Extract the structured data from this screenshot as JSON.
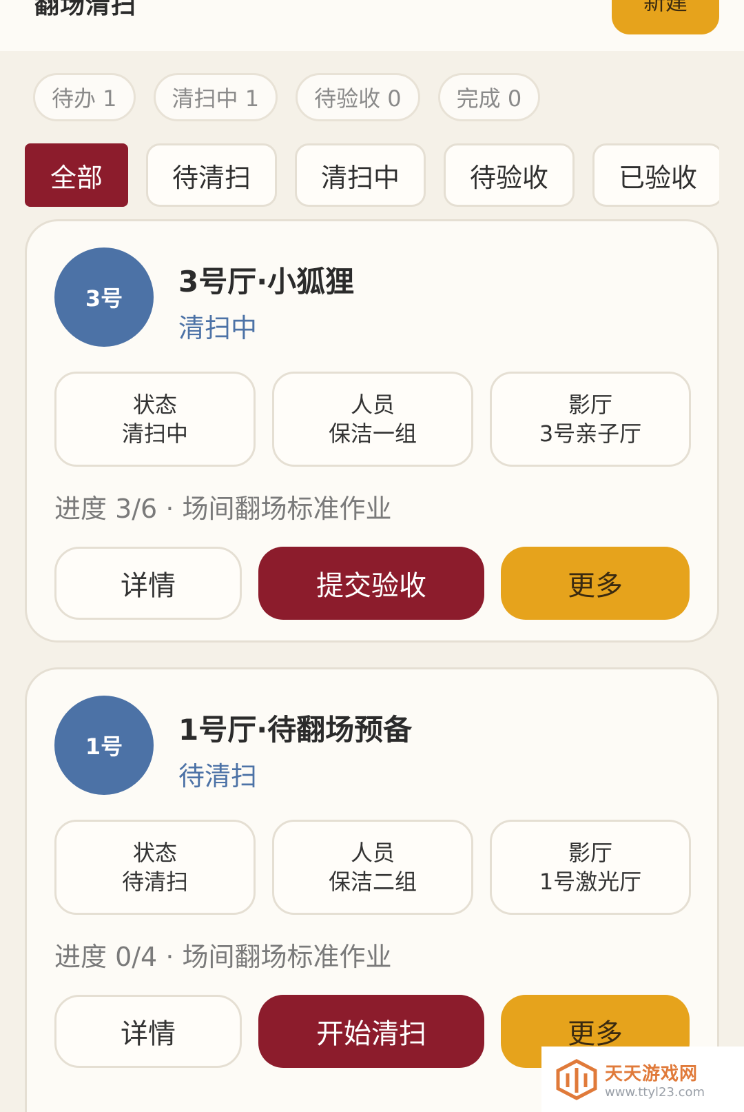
{
  "header": {
    "title": "翻场清扫",
    "new_button": "新建"
  },
  "count_chips": [
    {
      "label": "待办 1"
    },
    {
      "label": "清扫中 1"
    },
    {
      "label": "待验收 0"
    },
    {
      "label": "完成 0"
    }
  ],
  "filter_tabs": [
    {
      "label": "全部",
      "active": true
    },
    {
      "label": "待清扫",
      "active": false
    },
    {
      "label": "清扫中",
      "active": false
    },
    {
      "label": "待验收",
      "active": false
    },
    {
      "label": "已验收",
      "active": false
    }
  ],
  "cards": [
    {
      "avatar": "3号",
      "title": "3号厅·小狐狸",
      "status": "清扫中",
      "info": [
        {
          "label": "状态",
          "value": "清扫中"
        },
        {
          "label": "人员",
          "value": "保洁一组"
        },
        {
          "label": "影厅",
          "value": "3号亲子厅"
        }
      ],
      "progress": "进度 3/6 · 场间翻场标准作业",
      "actions": {
        "detail": "详情",
        "primary": "提交验收",
        "more": "更多"
      }
    },
    {
      "avatar": "1号",
      "title": "1号厅·待翻场预备",
      "status": "待清扫",
      "info": [
        {
          "label": "状态",
          "value": "待清扫"
        },
        {
          "label": "人员",
          "value": "保洁二组"
        },
        {
          "label": "影厅",
          "value": "1号激光厅"
        }
      ],
      "progress": "进度 0/4 · 场间翻场标准作业",
      "actions": {
        "detail": "详情",
        "primary": "开始清扫",
        "more": "更多"
      }
    }
  ],
  "watermark": {
    "name": "天天游戏网",
    "url": "www.ttyl23.com"
  },
  "colors": {
    "background": "#f5f1e8",
    "primary": "#8c1c2c",
    "accent": "#e6a31c",
    "status_blue": "#4c72a6"
  }
}
